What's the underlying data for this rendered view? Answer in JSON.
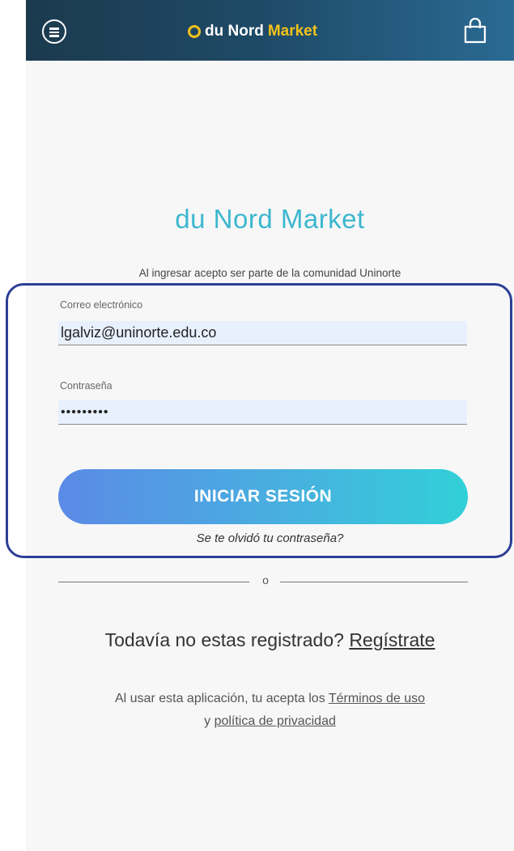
{
  "header": {
    "brand_part1": "du Nord",
    "brand_part2": "Market",
    "menu_icon": "menu-circle-icon",
    "cart_icon": "shopping-bag-icon"
  },
  "main": {
    "title": "du Nord Market",
    "subtitle": "Al ingresar acepto ser parte de la comunidad Uninorte",
    "email_label": "Correo electrónico",
    "email_value": "lgalviz@uninorte.edu.co",
    "password_label": "Contraseña",
    "password_value": "•••••••••",
    "login_button": "INICIAR SESIÓN",
    "forgot_link": "Se te olvidó tu contraseña?",
    "divider_text": "o",
    "register_prompt": "Todavía no estas registrado?",
    "register_link": "Regístrate",
    "terms_prefix": "Al usar esta aplicación, tu acepta los",
    "terms_link": "Términos de uso",
    "terms_connector": "y",
    "privacy_link": "política de privacidad"
  },
  "colors": {
    "header": "#1f4b68",
    "brand_accent": "#f2c21b",
    "title": "#3cb7cf",
    "button_start": "#5b8ae6",
    "button_end": "#31d0d8",
    "highlight_border": "#2b3f96"
  }
}
